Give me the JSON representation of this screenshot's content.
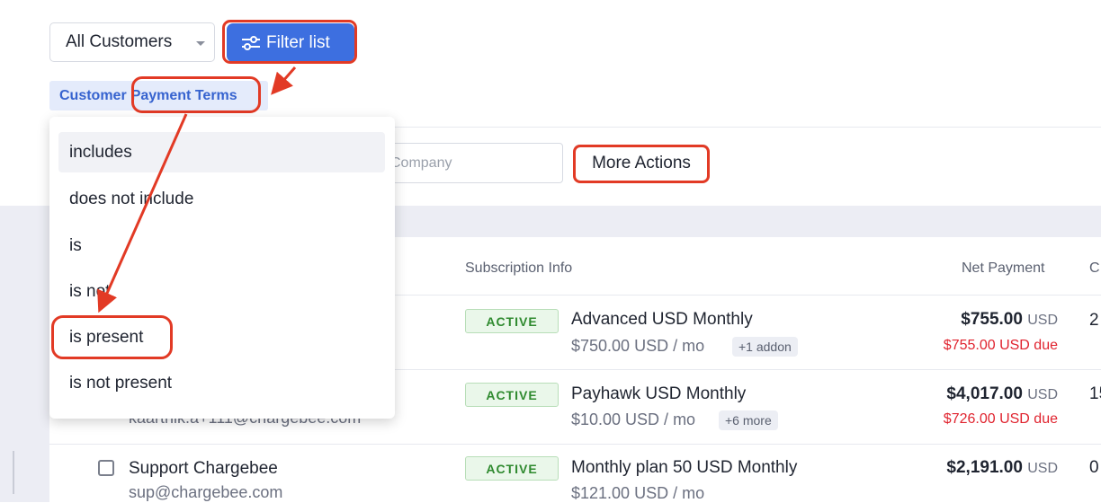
{
  "toolbar": {
    "customer_select": "All Customers",
    "filter_button": "Filter list",
    "filter_chip_prefix": "Customer",
    "filter_chip_field": "Payment Terms",
    "company_placeholder": "Company",
    "more_actions": "More Actions"
  },
  "dropdown": {
    "options": [
      "includes",
      "does not include",
      "is",
      "is not",
      "is present",
      "is not present"
    ],
    "hovered": "includes",
    "highlighted": "is present"
  },
  "table": {
    "headers": {
      "subscription": "Subscription Info",
      "net_payment": "Net Payment",
      "next_col": "C"
    },
    "rows": [
      {
        "status": "ACTIVE",
        "plan": "Advanced USD Monthly",
        "price": "$750.00 USD / mo",
        "extra": "+1 addon",
        "amount": "$755.00",
        "currency": "USD",
        "due": "$755.00 USD due",
        "next": "2"
      },
      {
        "customer_email": "kaarthik.a+111@chargebee.com",
        "status": "ACTIVE",
        "plan": "Payhawk USD Monthly",
        "price": "$10.00 USD / mo",
        "extra": "+6 more",
        "amount": "$4,017.00",
        "currency": "USD",
        "due": "$726.00 USD due",
        "next": "15"
      },
      {
        "customer_name": "Support Chargebee",
        "customer_email": "sup@chargebee.com",
        "status": "ACTIVE",
        "plan": "Monthly plan 50 USD Monthly",
        "price": "$121.00 USD / mo",
        "amount": "$2,191.00",
        "currency": "USD",
        "next": "0"
      }
    ]
  },
  "colors": {
    "primary": "#3d6fe0",
    "highlight": "#e23a25",
    "due": "#e0242f",
    "active": "#2f8a2f"
  }
}
